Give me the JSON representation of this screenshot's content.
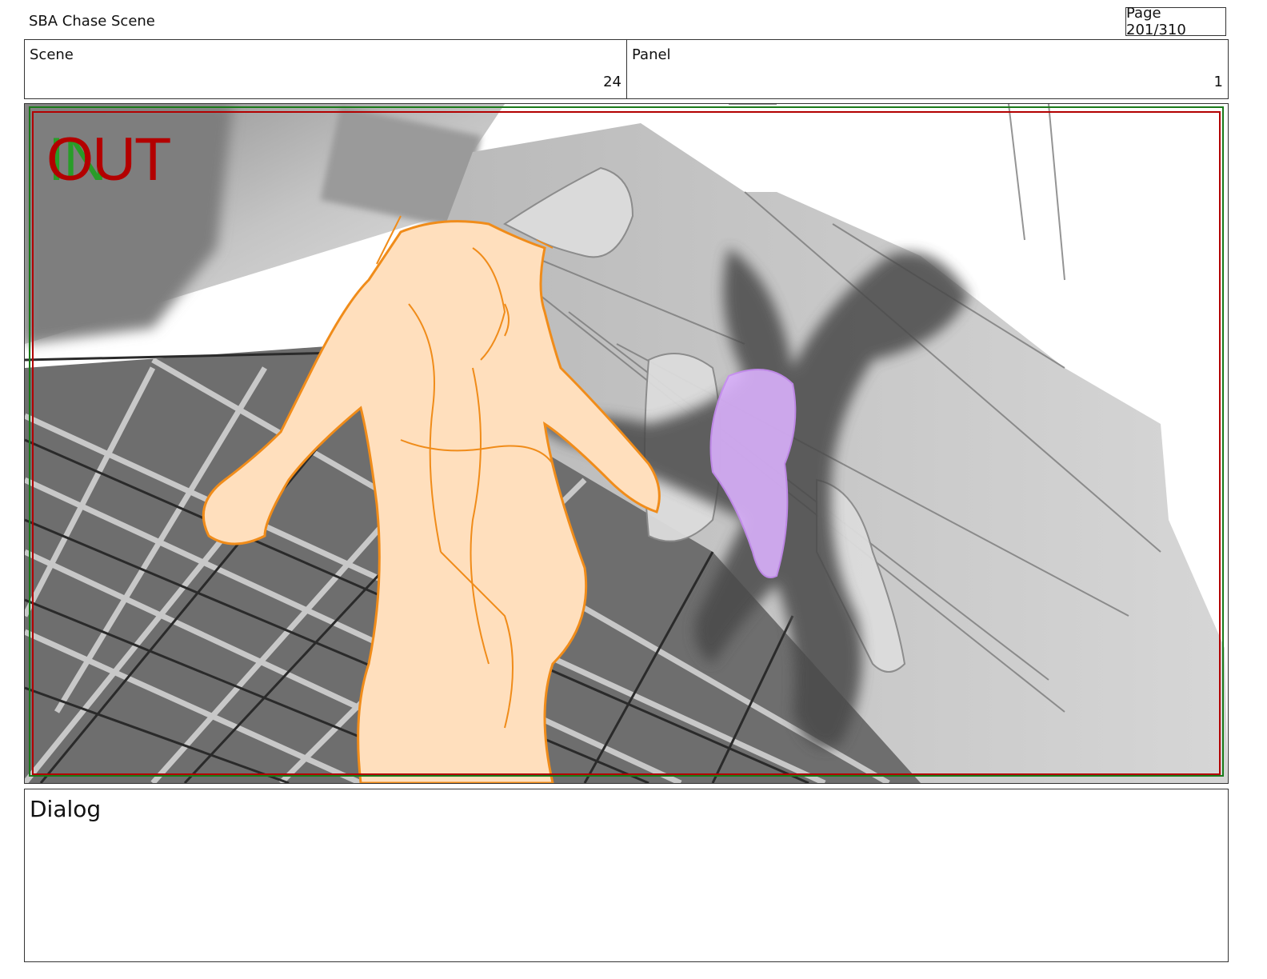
{
  "document": {
    "title": "SBA Chase Scene",
    "page_label": "Page 201/310"
  },
  "info": {
    "scene_label": "Scene",
    "scene_value": "24",
    "panel_label": "Panel",
    "panel_value": "1"
  },
  "frame": {
    "in_text": "IN",
    "out_text": "OUT",
    "colors": {
      "in": "#1aa31a",
      "out": "#b30000",
      "elf_fill": "#ffdfbd",
      "elf_line": "#f08c1a",
      "purple": "#c88cf5"
    }
  },
  "dialog": {
    "label": "Dialog"
  }
}
